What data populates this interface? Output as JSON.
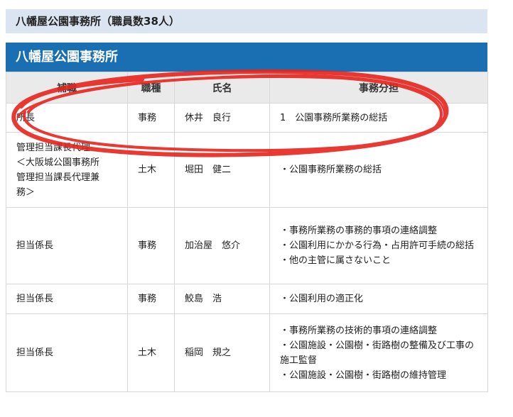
{
  "section_heading": "八幡屋公園事務所（職員数38人）",
  "table": {
    "caption": "八幡屋公園事務所",
    "headers": [
      "補職",
      "職種",
      "氏名",
      "事務分担"
    ],
    "rows": [
      {
        "position": "所長",
        "grade": "事務",
        "name": "休井　良行",
        "duties": [
          "1　公園事務所業務の総括"
        ]
      },
      {
        "position": "管理担当課長代理\n＜大阪城公園事務所管理担当課長代理兼務＞",
        "grade": "土木",
        "name": "堀田　健二",
        "duties": [
          "・公園事務所業務の総括"
        ]
      },
      {
        "position": "担当係長",
        "grade": "事務",
        "name": "加治屋　悠介",
        "duties": [
          "・事務所業務の事務的事項の連絡調整",
          "・公園利用にかかる行為・占用許可手続の総括",
          "・他の主管に属さないこと"
        ]
      },
      {
        "position": "担当係長",
        "grade": "事務",
        "name": "鮫島　浩",
        "duties": [
          "・公園利用の適正化"
        ]
      },
      {
        "position": "担当係長",
        "grade": "土木",
        "name": "稲岡　規之",
        "duties": [
          "・事務所業務の技術的事項の連絡調整",
          "・公園施設・公園樹・街路樹の整備及び工事の施工監督",
          "・公園施設・公園樹・街路樹の維持管理"
        ]
      }
    ]
  },
  "annotation": {
    "color": "#e8231c",
    "shape": "hand-drawn red ellipse around 所長 row"
  }
}
